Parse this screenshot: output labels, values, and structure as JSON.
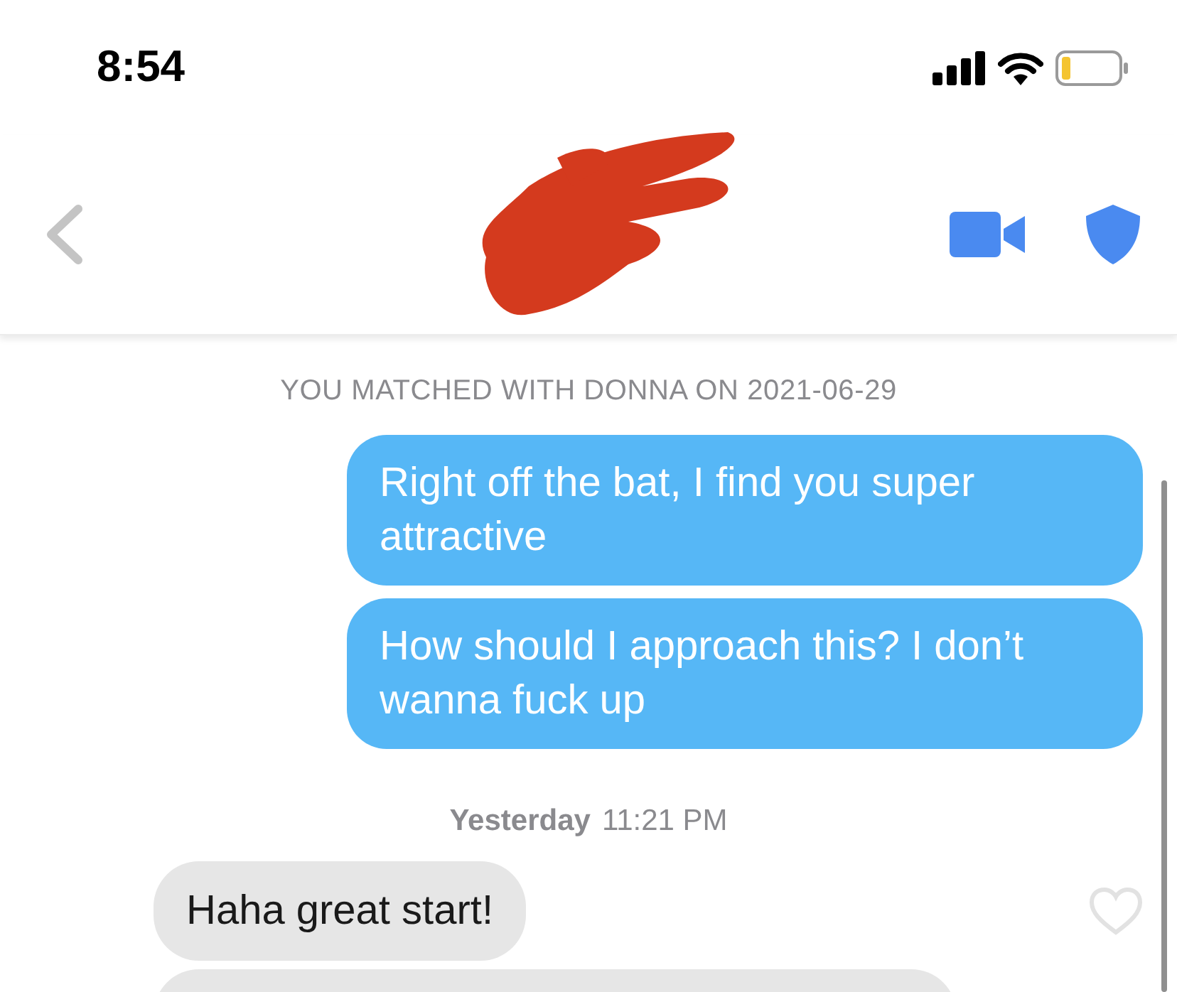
{
  "status_bar": {
    "time": "8:54"
  },
  "match_notice": "YOU MATCHED WITH DONNA ON 2021-06-29",
  "messages": [
    {
      "kind": "sent",
      "text": "Right off the bat, I find you super attractive"
    },
    {
      "kind": "sent",
      "text": "How should I approach this? I don’t wanna fuck up"
    },
    {
      "kind": "timestamp",
      "day": "Yesterday",
      "time": "11:21 PM"
    },
    {
      "kind": "received",
      "text": "Haha great start!",
      "liked": false
    },
    {
      "kind": "received_cut"
    }
  ]
}
